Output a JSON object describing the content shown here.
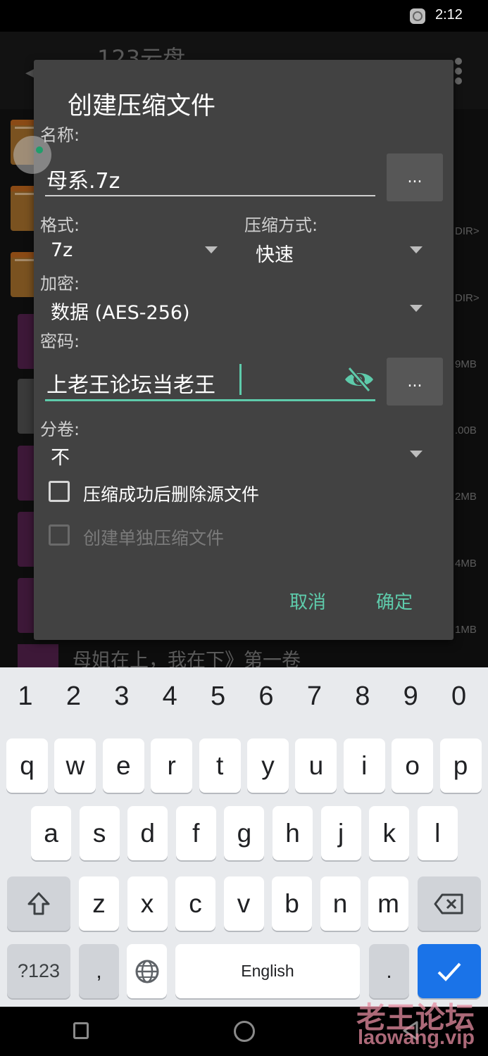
{
  "status_bar": {
    "time": "2:12",
    "notification_icon": "app-notification-icon"
  },
  "background_app": {
    "title": "123云盘",
    "file_sizes": [
      "DIR>",
      "DIR>",
      "9MB",
      ".00B",
      "2MB",
      "4MB",
      "1MB"
    ],
    "partial_row_text": "母姐在上，我在下》第一卷"
  },
  "dialog": {
    "title": "创建压缩文件",
    "name_label": "名称:",
    "name_value": "母系.7z",
    "browse_button_label": "...",
    "format_label": "格式:",
    "format_value": "7z",
    "compression_label": "压缩方式:",
    "compression_value": "快速",
    "encryption_label": "加密:",
    "encryption_value": "数据 (AES-256)",
    "password_label": "密码:",
    "password_value": "上老王论坛当老王",
    "password_more_label": "...",
    "split_label": "分卷:",
    "split_value": "不",
    "checkboxes": [
      {
        "label": "压缩成功后删除源文件",
        "checked": false,
        "enabled": true
      },
      {
        "label": "创建单独压缩文件",
        "checked": false,
        "enabled": false
      }
    ],
    "cancel_label": "取消",
    "ok_label": "确定"
  },
  "keyboard": {
    "number_row": [
      "1",
      "2",
      "3",
      "4",
      "5",
      "6",
      "7",
      "8",
      "9",
      "0"
    ],
    "row1": [
      "q",
      "w",
      "e",
      "r",
      "t",
      "y",
      "u",
      "i",
      "o",
      "p"
    ],
    "row2": [
      "a",
      "s",
      "d",
      "f",
      "g",
      "h",
      "j",
      "k",
      "l"
    ],
    "row3": [
      "z",
      "x",
      "c",
      "v",
      "b",
      "n",
      "m"
    ],
    "symbols_label": "?123",
    "comma_label": ",",
    "space_label": "English",
    "period_label": ".",
    "accent_color": "#1a73e8"
  },
  "watermark": {
    "text": "老王论坛",
    "url": "laowang.vip"
  },
  "colors": {
    "accent": "#5ecbab",
    "dialog_bg": "#424242",
    "keyboard_bg": "#e8eaed"
  }
}
